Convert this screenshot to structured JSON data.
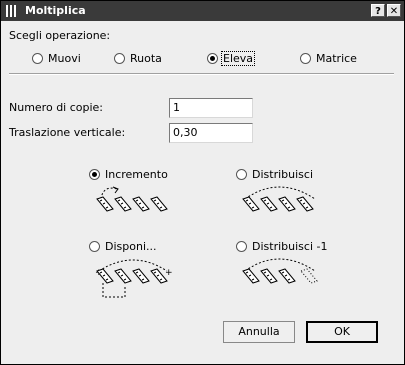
{
  "window": {
    "title": "Moltiplica",
    "help_label": "?",
    "close_label": "✕",
    "app_icon": "columns-icon"
  },
  "operation": {
    "label": "Scegli operazione:",
    "options": [
      {
        "label": "Muovi",
        "selected": false
      },
      {
        "label": "Ruota",
        "selected": false
      },
      {
        "label": "Eleva",
        "selected": true
      },
      {
        "label": "Matrice",
        "selected": false
      }
    ]
  },
  "copies": {
    "label": "Numero di copie:",
    "value": "1"
  },
  "offset": {
    "label": "Traslazione verticale:",
    "value": "0,30"
  },
  "distribution": {
    "options": [
      {
        "label": "Incremento",
        "selected": true
      },
      {
        "label": "Distribuisci",
        "selected": false
      },
      {
        "label": "Disponi...",
        "selected": false
      },
      {
        "label": "Distribuisci -1",
        "selected": false
      }
    ]
  },
  "buttons": {
    "cancel": "Annulla",
    "ok": "OK"
  },
  "colors": {
    "titlebar": "#3a3a3a",
    "dialog_bg": "#eeeeee"
  }
}
